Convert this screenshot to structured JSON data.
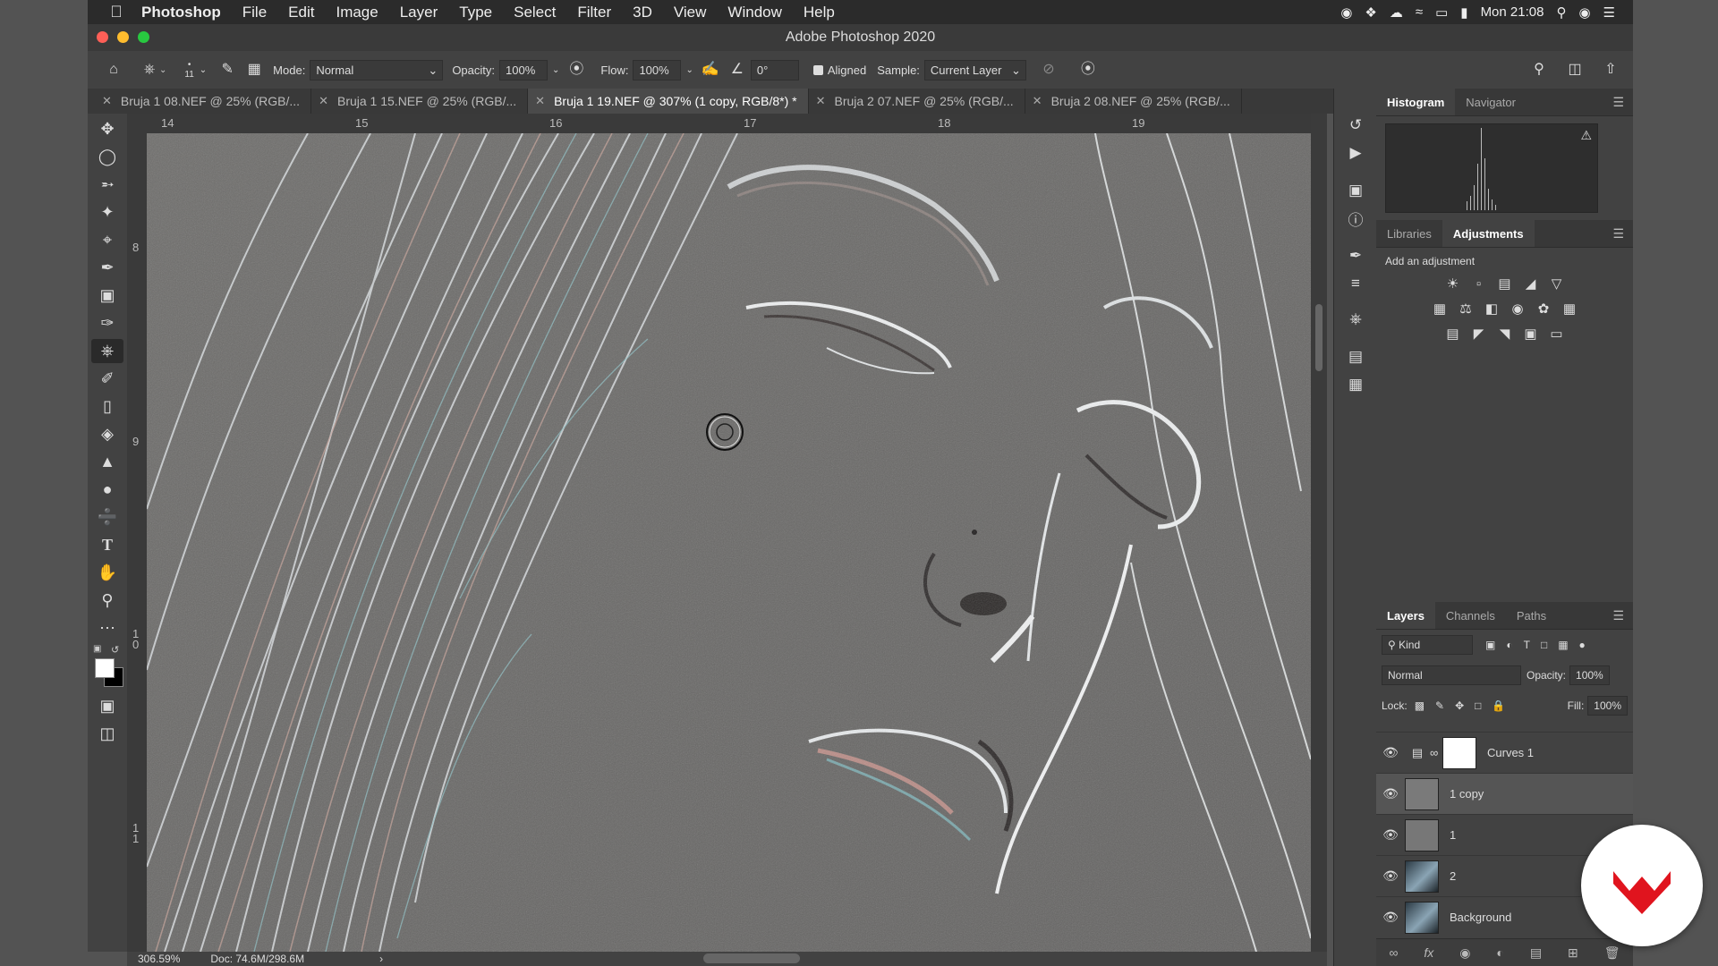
{
  "menubar": {
    "app": "Photoshop",
    "items": [
      "File",
      "Edit",
      "Image",
      "Layer",
      "Type",
      "Select",
      "Filter",
      "3D",
      "View",
      "Window",
      "Help"
    ],
    "clock": "Mon 21:08"
  },
  "window": {
    "title": "Adobe Photoshop 2020"
  },
  "options": {
    "brush_size": "11",
    "mode_label": "Mode:",
    "mode_value": "Normal",
    "opacity_label": "Opacity:",
    "opacity_value": "100%",
    "flow_label": "Flow:",
    "flow_value": "100%",
    "angle_value": "0°",
    "aligned_label": "Aligned",
    "sample_label": "Sample:",
    "sample_value": "Current Layer"
  },
  "tabs": [
    {
      "label": "Bruja 1 08.NEF @ 25% (RGB/..."
    },
    {
      "label": "Bruja 1 15.NEF @ 25% (RGB/..."
    },
    {
      "label": "Bruja 1 19.NEF @ 307% (1 copy, RGB/8*) *"
    },
    {
      "label": "Bruja 2 07.NEF @ 25% (RGB/..."
    },
    {
      "label": "Bruja 2 08.NEF @ 25% (RGB/..."
    }
  ],
  "ruler": {
    "h": [
      "14",
      "15",
      "16",
      "17",
      "18",
      "19"
    ],
    "v": [
      "8",
      "9",
      "1 0",
      "1 1"
    ]
  },
  "status": {
    "zoom": "306.59%",
    "doc": "Doc: 74.6M/298.6M"
  },
  "panels": {
    "top_tabs": [
      "Histogram",
      "Navigator"
    ],
    "mid_tabs": [
      "Libraries",
      "Adjustments"
    ],
    "add_adjustment": "Add an adjustment",
    "layer_tabs": [
      "Layers",
      "Channels",
      "Paths"
    ],
    "kind_label": "Kind",
    "blend_mode": "Normal",
    "opacity_label": "Opacity:",
    "opacity_value": "100%",
    "lock_label": "Lock:",
    "fill_label": "Fill:",
    "fill_value": "100%"
  },
  "layers": [
    {
      "name": "Curves 1"
    },
    {
      "name": "1 copy"
    },
    {
      "name": "1"
    },
    {
      "name": "2"
    },
    {
      "name": "Background"
    }
  ],
  "colors": {
    "accent": "#e0141e",
    "canvas": "#6d6c6a",
    "panel": "#424242"
  }
}
